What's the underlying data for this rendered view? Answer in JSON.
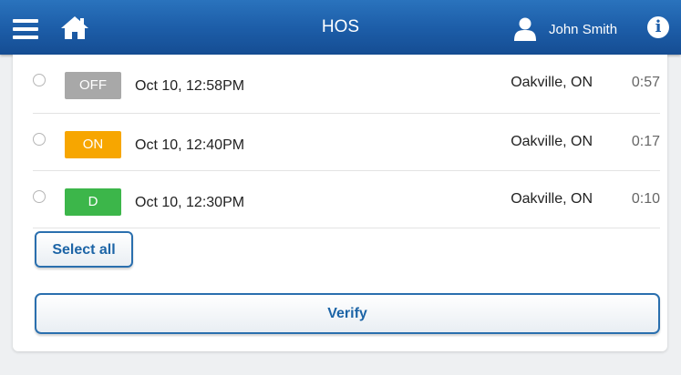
{
  "header": {
    "title": "HOS",
    "user_name": "John Smith",
    "menu_icon": "hamburger-menu-icon",
    "home_icon": "home-icon",
    "user_icon": "user-icon",
    "info_icon": "info-icon",
    "info_glyph": "i",
    "color": "#1d5ea9"
  },
  "logs": [
    {
      "status": "OFF",
      "status_color": "#a8a8a8",
      "time": "Oct 10, 12:58PM",
      "location": "Oakville, ON",
      "duration": "0:57"
    },
    {
      "status": "ON",
      "status_color": "#f7a600",
      "time": "Oct 10, 12:40PM",
      "location": "Oakville, ON",
      "duration": "0:17"
    },
    {
      "status": "D",
      "status_color": "#3cb64a",
      "time": "Oct 10, 12:30PM",
      "location": "Oakville, ON",
      "duration": "0:10"
    }
  ],
  "actions": {
    "select_all_label": "Select all",
    "verify_label": "Verify"
  }
}
